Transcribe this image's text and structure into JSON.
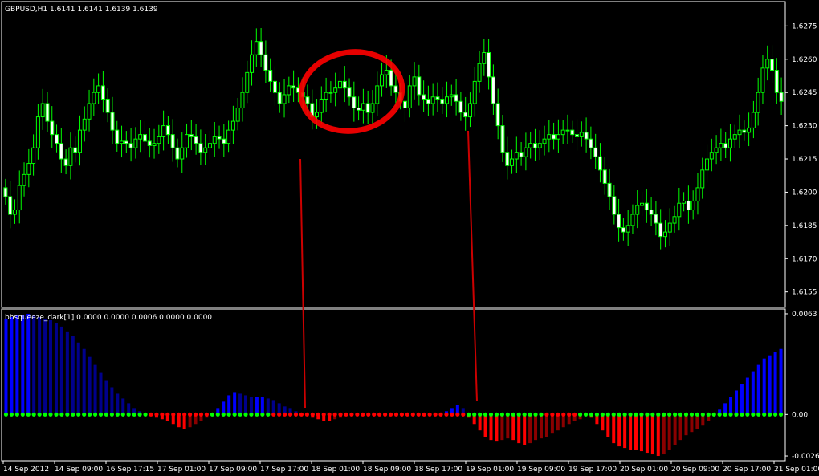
{
  "price_pane": {
    "header": "GBPUSD,H1  1.6141 1.6141 1.6139 1.6139"
  },
  "indicator_pane": {
    "header": "bbsqueeze_dark[1] 0.0000 0.0000 0.0006 0.0000 0.0000"
  },
  "colors": {
    "background": "#000000",
    "frame": "#ffffff",
    "wick": "#00ff00",
    "bull_body": "#000000",
    "bear_body": "#ffffff",
    "hist_pos_strong": "#0000ff",
    "hist_pos_weak": "#00008b",
    "hist_neg_strong": "#ff0000",
    "hist_neg_weak": "#8b0000",
    "dot_off": "#00ff00",
    "dot_on": "#ff0000",
    "annotation": "#cc0000"
  },
  "chart_data": [
    {
      "type": "candlestick",
      "symbol": "GBPUSD",
      "timeframe": "H1",
      "ylim": [
        1.6148,
        1.6286
      ],
      "y_ticks": [
        "1.6275",
        "1.6260",
        "1.6245",
        "1.6230",
        "1.6215",
        "1.6200",
        "1.6185",
        "1.6170",
        "1.6155"
      ],
      "x_ticks": [
        "14 Sep 2012",
        "14 Sep 09:00",
        "16 Sep 17:15",
        "17 Sep 01:00",
        "17 Sep 09:00",
        "17 Sep 17:00",
        "18 Sep 01:00",
        "18 Sep 09:00",
        "18 Sep 17:00",
        "19 Sep 01:00",
        "19 Sep 09:00",
        "19 Sep 17:00",
        "20 Sep 01:00",
        "20 Sep 09:00",
        "20 Sep 17:00",
        "21 Sep 01:00"
      ],
      "close": [
        1.6198,
        1.619,
        1.6192,
        1.6203,
        1.6208,
        1.6213,
        1.622,
        1.6234,
        1.624,
        1.6232,
        1.6226,
        1.6222,
        1.6215,
        1.6212,
        1.622,
        1.6218,
        1.6228,
        1.6233,
        1.624,
        1.6245,
        1.6248,
        1.6242,
        1.6236,
        1.6228,
        1.6222,
        1.6223,
        1.6222,
        1.622,
        1.6224,
        1.6226,
        1.6223,
        1.6221,
        1.6222,
        1.6225,
        1.623,
        1.6226,
        1.622,
        1.6215,
        1.622,
        1.6226,
        1.6225,
        1.6222,
        1.6218,
        1.622,
        1.6222,
        1.6225,
        1.6224,
        1.6222,
        1.6228,
        1.6232,
        1.6238,
        1.6245,
        1.6254,
        1.6262,
        1.6268,
        1.6262,
        1.6255,
        1.625,
        1.6245,
        1.624,
        1.6244,
        1.6248,
        1.6247,
        1.6245,
        1.6243,
        1.624,
        1.6234,
        1.6236,
        1.6242,
        1.6245,
        1.6245,
        1.6247,
        1.625,
        1.6247,
        1.6243,
        1.6238,
        1.6237,
        1.624,
        1.6236,
        1.624,
        1.6248,
        1.6253,
        1.6255,
        1.6248,
        1.6245,
        1.6241,
        1.6238,
        1.6248,
        1.6252,
        1.6244,
        1.6242,
        1.624,
        1.6243,
        1.6242,
        1.624,
        1.6243,
        1.6244,
        1.6241,
        1.6236,
        1.6234,
        1.624,
        1.625,
        1.6258,
        1.6263,
        1.6252,
        1.624,
        1.623,
        1.6218,
        1.6212,
        1.6215,
        1.6218,
        1.6216,
        1.622,
        1.6222,
        1.622,
        1.6222,
        1.6224,
        1.6226,
        1.6224,
        1.6226,
        1.6228,
        1.6228,
        1.6226,
        1.6225,
        1.6227,
        1.6224,
        1.622,
        1.6216,
        1.621,
        1.6204,
        1.6198,
        1.619,
        1.6184,
        1.6182,
        1.6185,
        1.619,
        1.6194,
        1.6195,
        1.6192,
        1.619,
        1.6186,
        1.618,
        1.6182,
        1.6186,
        1.6189,
        1.6195,
        1.6196,
        1.6192,
        1.6196,
        1.6202,
        1.621,
        1.6215,
        1.6218,
        1.622,
        1.6222,
        1.622,
        1.6224,
        1.6226,
        1.6228,
        1.6227,
        1.6229,
        1.6236,
        1.6245,
        1.6256,
        1.626,
        1.6255,
        1.6245,
        1.6241
      ],
      "y_label_format": "4 decimals"
    },
    {
      "type": "bar",
      "indicator": "bbsqueeze_dark[1]",
      "ylim": [
        -0.0029,
        0.0066
      ],
      "y_ticks": [
        "0.0063",
        "0.00",
        "-0.0026"
      ],
      "x_ticks": [
        "14 Sep 2012",
        "14 Sep 09:00",
        "16 Sep 17:15",
        "17 Sep 01:00",
        "17 Sep 09:00",
        "17 Sep 17:00",
        "18 Sep 01:00",
        "18 Sep 09:00",
        "18 Sep 17:00",
        "19 Sep 01:00",
        "19 Sep 09:00",
        "19 Sep 17:00",
        "20 Sep 01:00",
        "20 Sep 09:00",
        "20 Sep 17:00",
        "21 Sep 01:00"
      ],
      "values": [
        0.006,
        0.0061,
        0.0062,
        0.0062,
        0.0063,
        0.0062,
        0.0061,
        0.006,
        0.0059,
        0.0057,
        0.0055,
        0.0052,
        0.0049,
        0.0045,
        0.0041,
        0.0036,
        0.0031,
        0.0026,
        0.0021,
        0.0017,
        0.0013,
        0.001,
        0.0007,
        0.0004,
        0.0002,
        0.0001,
        -0.0001,
        -0.0002,
        -0.0003,
        -0.0004,
        -0.0006,
        -0.0008,
        -0.0009,
        -0.0008,
        -0.0006,
        -0.0004,
        -0.0002,
        0.0001,
        0.0004,
        0.0008,
        0.0012,
        0.0014,
        0.0013,
        0.0012,
        0.0011,
        0.0011,
        0.0011,
        0.001,
        0.0009,
        0.0007,
        0.0005,
        0.0004,
        0.0002,
        0.0001,
        -0.0001,
        -0.0002,
        -0.0003,
        -0.0004,
        -0.0004,
        -0.0003,
        -0.0002,
        -0.0001,
        -0.0001,
        0.0,
        0.0001,
        0.0001,
        0.0001,
        0.0,
        0.0,
        -0.0001,
        -0.0001,
        0.0,
        0.0,
        0.0,
        0.0001,
        0.0001,
        0.0001,
        0.0,
        0.0001,
        0.0002,
        0.0004,
        0.0006,
        0.0004,
        -0.0002,
        -0.0006,
        -0.001,
        -0.0014,
        -0.0016,
        -0.0017,
        -0.0016,
        -0.0015,
        -0.0016,
        -0.0018,
        -0.0019,
        -0.0018,
        -0.0016,
        -0.0015,
        -0.0014,
        -0.0012,
        -0.001,
        -0.0008,
        -0.0006,
        -0.0004,
        -0.0003,
        -0.0001,
        -0.0002,
        -0.0006,
        -0.001,
        -0.0014,
        -0.0018,
        -0.002,
        -0.0021,
        -0.0022,
        -0.0022,
        -0.0023,
        -0.0024,
        -0.0025,
        -0.0026,
        -0.0025,
        -0.0022,
        -0.0019,
        -0.0016,
        -0.0013,
        -0.0011,
        -0.0009,
        -0.0007,
        -0.0004,
        -0.0001,
        0.0003,
        0.0007,
        0.0011,
        0.0015,
        0.0019,
        0.0023,
        0.0027,
        0.0031,
        0.0035,
        0.0037,
        0.0039,
        0.0041
      ],
      "positive_color": "blue",
      "negative_color": "red",
      "zero_line_dots": "green = squeeze off, red = squeeze on"
    }
  ]
}
